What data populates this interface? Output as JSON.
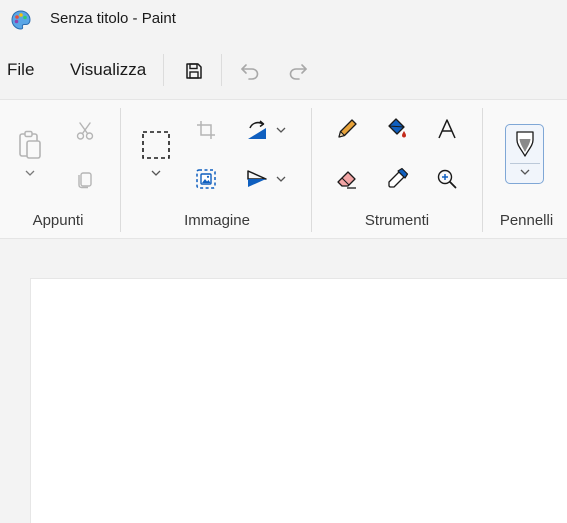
{
  "window": {
    "title": "Senza titolo - Paint"
  },
  "menu": {
    "file": "File",
    "view": "Visualizza"
  },
  "ribbon": {
    "groups": {
      "clipboard": "Appunti",
      "image": "Immagine",
      "tools": "Strumenti",
      "brushes": "Pennelli"
    }
  },
  "colors": {
    "accent": "#0f5fbf",
    "pencil": "#e8a33a",
    "eraser": "#f2a5a5",
    "fill_drop": "#c42b1c"
  }
}
